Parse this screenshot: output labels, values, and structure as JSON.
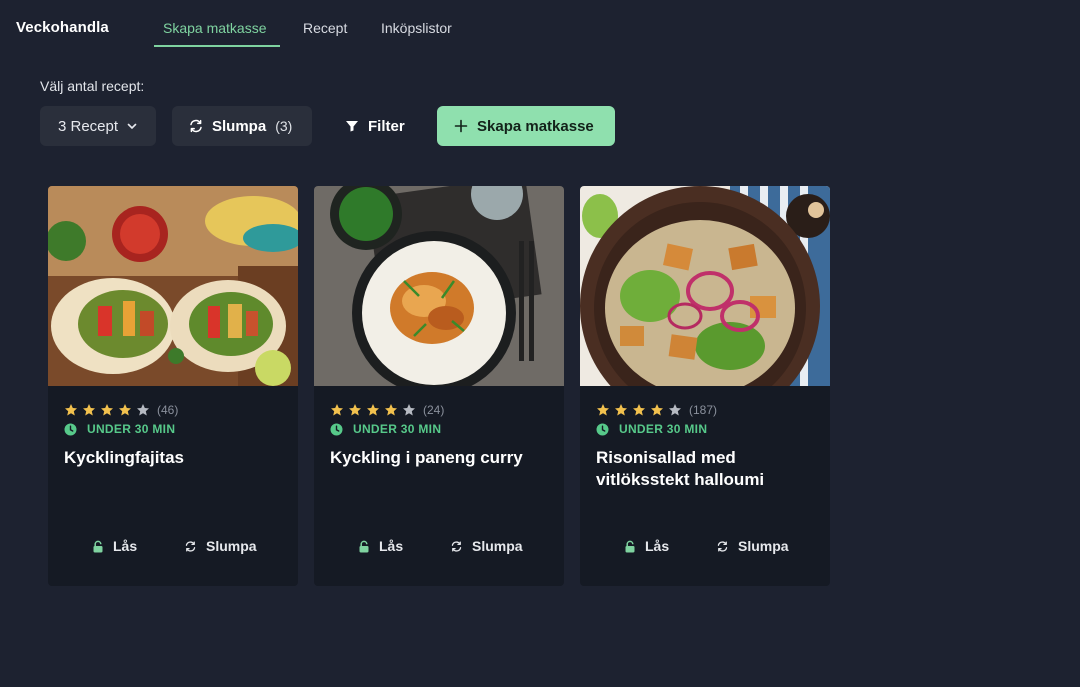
{
  "nav": {
    "brand": "Veckohandla",
    "tabs": [
      {
        "label": "Skapa matkasse",
        "active": true
      },
      {
        "label": "Recept",
        "active": false
      },
      {
        "label": "Inköpslistor",
        "active": false
      }
    ]
  },
  "controls": {
    "label": "Välj antal recept:",
    "recipe_count_select": "3 Recept",
    "random_label": "Slumpa",
    "random_count": "(3)",
    "filter_label": "Filter",
    "create_label": "Skapa matkasse"
  },
  "colors": {
    "accent": "#7fd3a0",
    "create_button": "#8fe0ae",
    "time_badge": "#57c98a",
    "star": "#f2c14e",
    "background": "#1d2230",
    "card": "#151a24"
  },
  "recipes": [
    {
      "rating": 4,
      "reviews": "(46)",
      "time": "UNDER 30 MIN",
      "title": "Kycklingfajitas",
      "lock_label": "Lås",
      "random_label": "Slumpa"
    },
    {
      "rating": 4,
      "reviews": "(24)",
      "time": "UNDER 30 MIN",
      "title": "Kyckling i paneng curry",
      "lock_label": "Lås",
      "random_label": "Slumpa"
    },
    {
      "rating": 4,
      "reviews": "(187)",
      "time": "UNDER 30 MIN",
      "title": "Risonisallad med vitlöksstekt halloumi",
      "lock_label": "Lås",
      "random_label": "Slumpa"
    }
  ]
}
